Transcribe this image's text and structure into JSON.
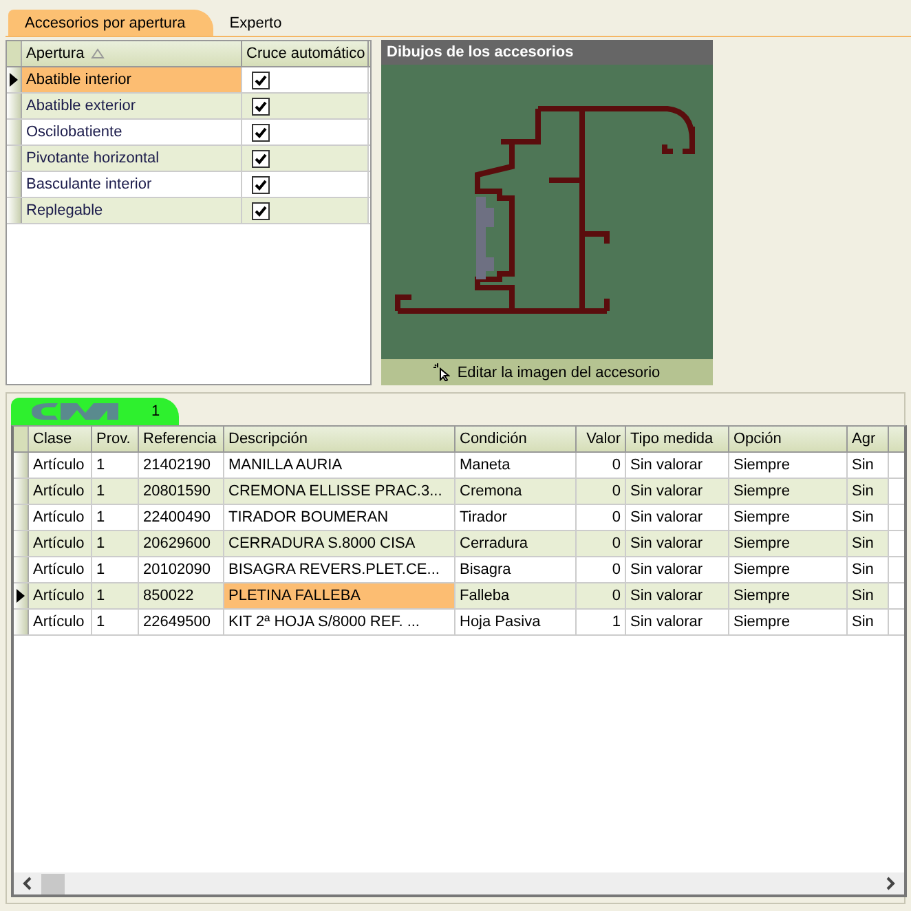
{
  "tabs": [
    {
      "label": "Accesorios por apertura",
      "selected": true
    },
    {
      "label": "Experto",
      "selected": false
    }
  ],
  "apertura_grid": {
    "columns": [
      "Apertura",
      "Cruce automático"
    ],
    "rows": [
      {
        "apertura": "Abatible interior",
        "checked": true,
        "selected": true
      },
      {
        "apertura": "Abatible exterior",
        "checked": true,
        "selected": false
      },
      {
        "apertura": "Oscilobatiente",
        "checked": true,
        "selected": false
      },
      {
        "apertura": "Pivotante horizontal",
        "checked": true,
        "selected": false
      },
      {
        "apertura": "Basculante interior",
        "checked": true,
        "selected": false
      },
      {
        "apertura": "Replegable",
        "checked": true,
        "selected": false
      }
    ]
  },
  "accessory_panel": {
    "title": "Dibujos de los accesorios",
    "edit_button": "Editar la imagen del accesorio"
  },
  "group_tab": {
    "label": "1",
    "selected": true
  },
  "articles_grid": {
    "columns": [
      "Clase",
      "Prov.",
      "Referencia",
      "Descripción",
      "Condición",
      "Valor",
      "Tipo medida",
      "Opción",
      "Agr"
    ],
    "rows": [
      {
        "cells": [
          "Artículo",
          "1",
          "21402190",
          "MANILLA AURIA",
          "Maneta",
          "0",
          "Sin valorar",
          "Siempre",
          "Sin"
        ],
        "selected": false
      },
      {
        "cells": [
          "Artículo",
          "1",
          "20801590",
          "CREMONA ELLISSE PRAC.3...",
          "Cremona",
          "0",
          "Sin valorar",
          "Siempre",
          "Sin"
        ],
        "selected": false
      },
      {
        "cells": [
          "Artículo",
          "1",
          "22400490",
          "TIRADOR BOUMERAN",
          "Tirador",
          "0",
          "Sin valorar",
          "Siempre",
          "Sin"
        ],
        "selected": false
      },
      {
        "cells": [
          "Artículo",
          "1",
          "20629600",
          "CERRADURA S.8000 CISA",
          "Cerradura",
          "0",
          "Sin valorar",
          "Siempre",
          "Sin"
        ],
        "selected": false
      },
      {
        "cells": [
          "Artículo",
          "1",
          "20102090",
          "BISAGRA REVERS.PLET.CE...",
          "Bisagra",
          "0",
          "Sin valorar",
          "Siempre",
          "Sin"
        ],
        "selected": false
      },
      {
        "cells": [
          "Artículo",
          "1",
          "850022",
          "PLETINA FALLEBA",
          "Falleba",
          "0",
          "Sin valorar",
          "Siempre",
          "Sin"
        ],
        "selected": true
      },
      {
        "cells": [
          "Artículo",
          "1",
          "22649500",
          "KIT 2ª HOJA S/8000 REF. ...",
          "Hoja Pasiva",
          "1",
          "Sin valorar",
          "Siempre",
          "Sin"
        ],
        "selected": false
      }
    ]
  }
}
